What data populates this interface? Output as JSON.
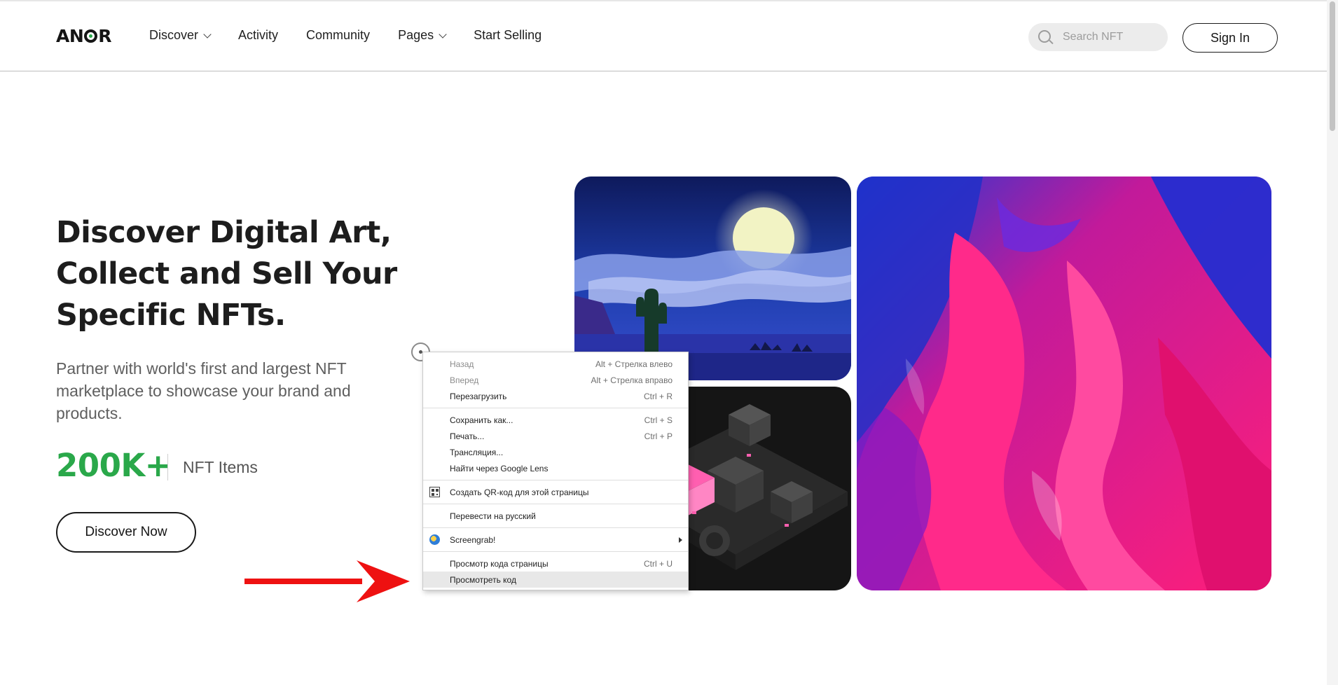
{
  "header": {
    "logo": "ANOR",
    "nav": [
      {
        "label": "Discover",
        "has_dropdown": true
      },
      {
        "label": "Activity",
        "has_dropdown": false
      },
      {
        "label": "Community",
        "has_dropdown": false
      },
      {
        "label": "Pages",
        "has_dropdown": true
      },
      {
        "label": "Start Selling",
        "has_dropdown": false
      }
    ],
    "search_placeholder": "Search NFT",
    "signin_label": "Sign In"
  },
  "hero": {
    "title_lines": [
      "Discover Digital Art,",
      "Collect and Sell Your",
      "Specific NFTs."
    ],
    "subtitle": "Partner with world's first and largest NFT marketplace to showcase your brand and products.",
    "stat_value": "200K+",
    "stat_label": "NFT Items",
    "cta_label": "Discover Now"
  },
  "artworks": [
    {
      "icon": "desert-night-artwork"
    },
    {
      "icon": "isometric-city-artwork"
    },
    {
      "icon": "abstract-paint-artwork"
    }
  ],
  "context_menu": {
    "groups": [
      [
        {
          "label": "Назад",
          "shortcut": "Alt + Стрелка влево",
          "enabled": false
        },
        {
          "label": "Вперед",
          "shortcut": "Alt + Стрелка вправо",
          "enabled": false
        },
        {
          "label": "Перезагрузить",
          "shortcut": "Ctrl + R",
          "enabled": true
        }
      ],
      [
        {
          "label": "Сохранить как...",
          "shortcut": "Ctrl + S",
          "enabled": true
        },
        {
          "label": "Печать...",
          "shortcut": "Ctrl + P",
          "enabled": true
        },
        {
          "label": "Трансляция...",
          "shortcut": "",
          "enabled": true
        },
        {
          "label": "Найти через Google Lens",
          "shortcut": "",
          "enabled": true
        }
      ],
      [
        {
          "label": "Создать QR-код для этой страницы",
          "shortcut": "",
          "enabled": true,
          "icon": "qr-code-icon"
        }
      ],
      [
        {
          "label": "Перевести на русский",
          "shortcut": "",
          "enabled": true
        }
      ],
      [
        {
          "label": "Screengrab!",
          "shortcut": "",
          "enabled": true,
          "icon": "screengrab-icon",
          "submenu": true
        }
      ],
      [
        {
          "label": "Просмотр кода страницы",
          "shortcut": "Ctrl + U",
          "enabled": true
        },
        {
          "label": "Просмотреть код",
          "shortcut": "",
          "enabled": true,
          "highlighted": true
        }
      ]
    ]
  },
  "colors": {
    "accent_green": "#2aa84a",
    "annotation_red": "#ee1111",
    "text_dark": "#1d1d1d",
    "text_muted": "#5f5f5f"
  }
}
